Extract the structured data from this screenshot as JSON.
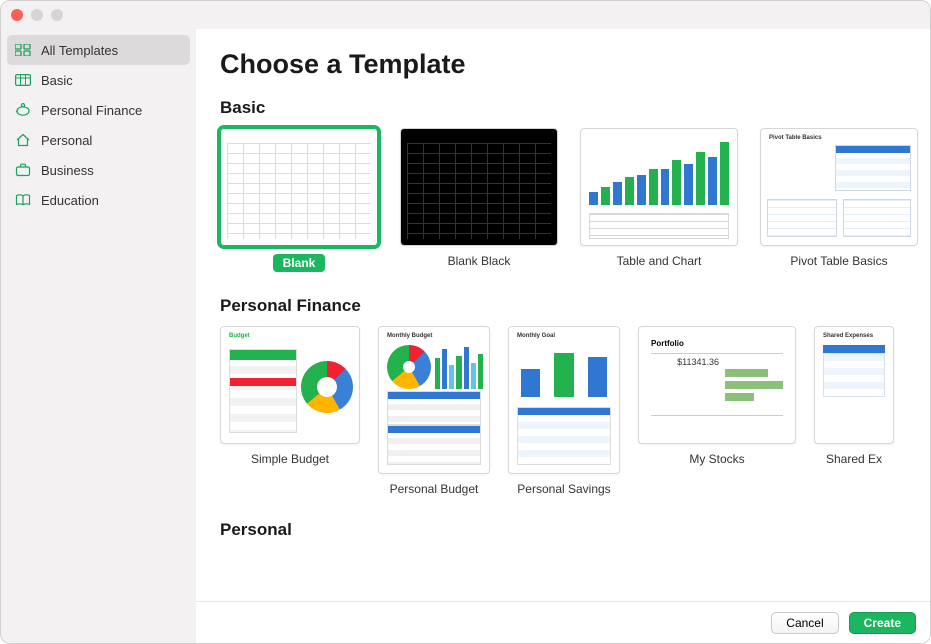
{
  "colors": {
    "accent": "#1cb560"
  },
  "titlebar": {
    "close": "close",
    "minimize": "minimize",
    "zoom": "zoom"
  },
  "sidebar": {
    "items": [
      {
        "label": "All Templates",
        "icon": "grid-icon",
        "selected": true
      },
      {
        "label": "Basic",
        "icon": "table-icon",
        "selected": false
      },
      {
        "label": "Personal Finance",
        "icon": "piggybank-icon",
        "selected": false
      },
      {
        "label": "Personal",
        "icon": "home-icon",
        "selected": false
      },
      {
        "label": "Business",
        "icon": "briefcase-icon",
        "selected": false
      },
      {
        "label": "Education",
        "icon": "book-icon",
        "selected": false
      }
    ]
  },
  "main": {
    "title": "Choose a Template",
    "sections": [
      {
        "title": "Basic",
        "templates": [
          {
            "label": "Blank",
            "selected": true
          },
          {
            "label": "Blank Black",
            "selected": false
          },
          {
            "label": "Table and Chart",
            "selected": false
          },
          {
            "label": "Pivot Table Basics",
            "selected": false
          }
        ]
      },
      {
        "title": "Personal Finance",
        "templates": [
          {
            "label": "Simple Budget",
            "selected": false
          },
          {
            "label": "Personal Budget",
            "selected": false
          },
          {
            "label": "Personal Savings",
            "selected": false
          },
          {
            "label": "My Stocks",
            "selected": false
          },
          {
            "label": "Shared Expenses",
            "selected": false,
            "truncated": "Shared Ex"
          }
        ]
      },
      {
        "title": "Personal",
        "templates": []
      }
    ]
  },
  "footer": {
    "cancel": "Cancel",
    "create": "Create"
  }
}
